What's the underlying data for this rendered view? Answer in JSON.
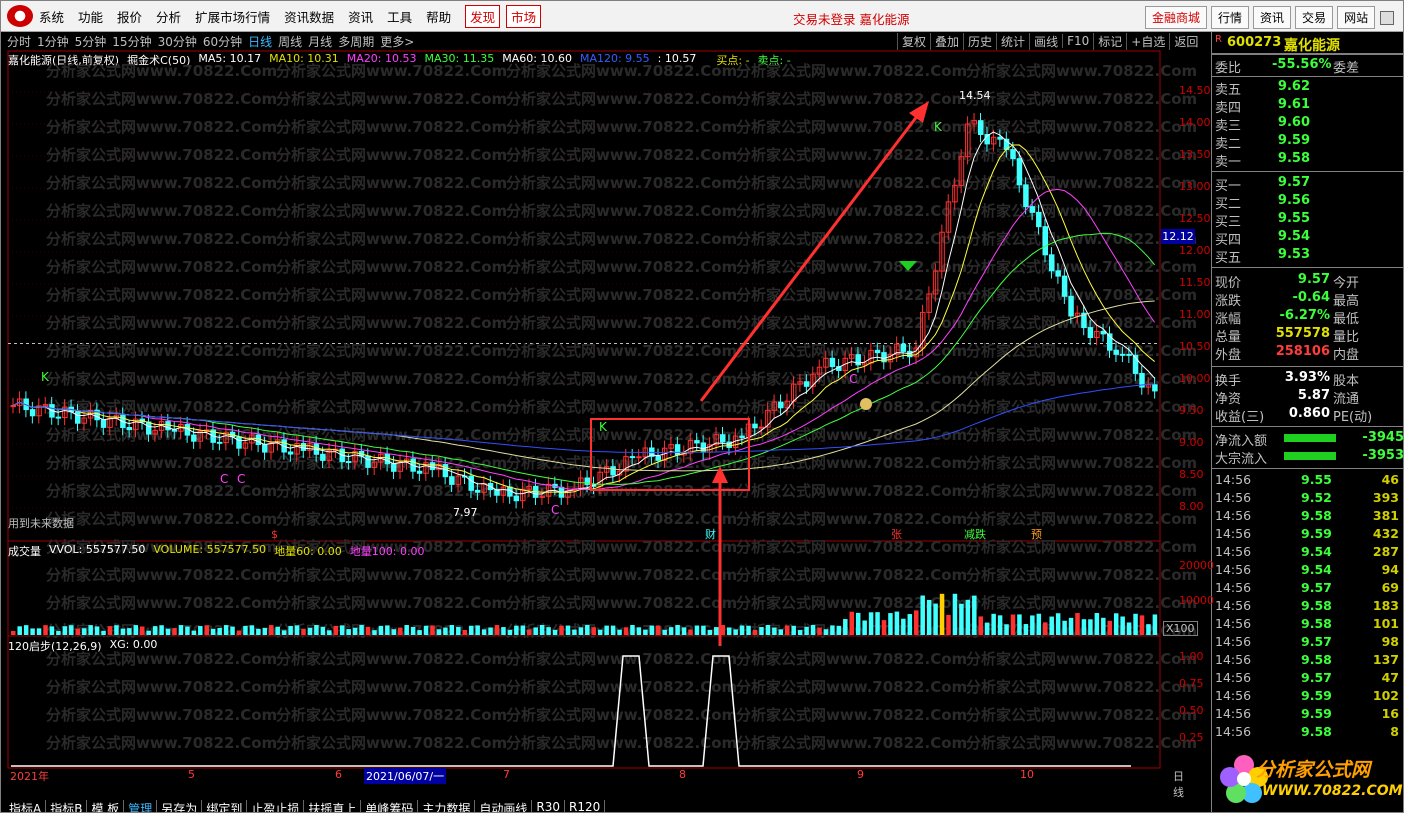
{
  "menu": {
    "items": [
      "系统",
      "功能",
      "报价",
      "分析",
      "扩展市场行情",
      "资讯数据",
      "资讯",
      "工具",
      "帮助"
    ],
    "red_items": [
      "发现",
      "市场"
    ],
    "center_text": "交易未登录  嘉化能源",
    "right_buttons": [
      "金融商城",
      "行情",
      "资讯",
      "交易",
      "网站"
    ]
  },
  "period": {
    "items": [
      "分时",
      "1分钟",
      "5分钟",
      "15分钟",
      "30分钟",
      "60分钟",
      "日线",
      "周线",
      "月线",
      "多周期",
      "更多>"
    ],
    "active": "日线",
    "tools": [
      "复权",
      "叠加",
      "历史",
      "统计",
      "画线",
      "F10",
      "标记",
      "+自选",
      "返回"
    ]
  },
  "chart_legend": {
    "name": "嘉化能源(日线,前复权)",
    "indicator": "掘金术C(50)",
    "ma5": "MA5: 10.17",
    "ma10": "MA10: 10.31",
    "ma20": "MA20: 10.53",
    "ma30": "MA30: 11.35",
    "ma60": "MA60: 10.60",
    "ma120": "MA120: 9.55",
    "extra": ": 10.57",
    "buy": "买点: -",
    "sell": "卖点: -"
  },
  "annotations": {
    "high": "14.54",
    "low": "7.97",
    "future_note": "用到未来数据",
    "current_price_tag": "12.12",
    "k1": "K",
    "k2": "K",
    "k3": "K",
    "c1": "C",
    "c2": "C",
    "c3": "C",
    "c4": "C"
  },
  "events": [
    "$",
    "财",
    "张",
    "减跌",
    "预"
  ],
  "volume_legend": {
    "name": "成交量",
    "vvol": "VVOL: 557577.50",
    "volume": "VOLUME: 557577.50",
    "dl60": "地量60: 0.00",
    "dl100": "地量100: 0.00",
    "x100": "X100"
  },
  "step_legend": {
    "name": "120启步(12,26,9)",
    "xg": "XG: 0.00"
  },
  "xaxis": {
    "labels": [
      "2021年",
      "5",
      "6",
      "2021/06/07/一",
      "7",
      "8",
      "9",
      "10"
    ],
    "right": "日线"
  },
  "tabs": [
    "指标A",
    "指标B",
    "模 板",
    "管理",
    "另存为",
    "绑定到",
    "止盈止损",
    "扶摇直上",
    "单峰筹码",
    "主力数据",
    "自动画线",
    "R30",
    "R120"
  ],
  "active_tab": "管理",
  "y_main": [
    "14.50",
    "14.00",
    "13.50",
    "13.00",
    "12.50",
    "12.00",
    "11.50",
    "11.00",
    "10.50",
    "10.00",
    "9.50",
    "9.00",
    "8.50",
    "8.00"
  ],
  "y_vol": [
    "20000",
    "10000"
  ],
  "y_step": [
    "1.00",
    "0.75",
    "0.50",
    "0.25"
  ],
  "watermark": "分析家公式网www.70822.Com",
  "quote": {
    "code": "600273",
    "name": "嘉化能源",
    "r": "R",
    "weibi_label": "委比",
    "weibi": "-55.56%",
    "weicha_label": "委差",
    "sell": [
      {
        "label": "卖五",
        "price": "9.62"
      },
      {
        "label": "卖四",
        "price": "9.61"
      },
      {
        "label": "卖三",
        "price": "9.60"
      },
      {
        "label": "卖二",
        "price": "9.59"
      },
      {
        "label": "卖一",
        "price": "9.58"
      }
    ],
    "buy": [
      {
        "label": "买一",
        "price": "9.57"
      },
      {
        "label": "买二",
        "price": "9.56"
      },
      {
        "label": "买三",
        "price": "9.55"
      },
      {
        "label": "买四",
        "price": "9.54"
      },
      {
        "label": "买五",
        "price": "9.53"
      }
    ],
    "stats": [
      {
        "label": "现价",
        "value": "9.57",
        "right": "今开"
      },
      {
        "label": "涨跌",
        "value": "-0.64",
        "right": "最高"
      },
      {
        "label": "涨幅",
        "value": "-6.27%",
        "right": "最低"
      },
      {
        "label": "总量",
        "value": "557578",
        "right": "量比"
      },
      {
        "label": "外盘",
        "value": "258106",
        "right": "内盘"
      }
    ],
    "stats2": [
      {
        "label": "换手",
        "value": "3.93%",
        "right": "股本"
      },
      {
        "label": "净资",
        "value": "5.87",
        "right": "流通"
      },
      {
        "label": "收益(三)",
        "value": "0.860",
        "right": "PE(动)"
      }
    ],
    "flow": [
      {
        "label": "净流入额",
        "value": "-3945"
      },
      {
        "label": "大宗流入",
        "value": "-3953"
      }
    ],
    "ticks": [
      {
        "t": "14:56",
        "p": "9.55",
        "v": "46"
      },
      {
        "t": "14:56",
        "p": "9.52",
        "v": "393"
      },
      {
        "t": "14:56",
        "p": "9.58",
        "v": "381"
      },
      {
        "t": "14:56",
        "p": "9.59",
        "v": "432"
      },
      {
        "t": "14:56",
        "p": "9.54",
        "v": "287"
      },
      {
        "t": "14:56",
        "p": "9.54",
        "v": "94"
      },
      {
        "t": "14:56",
        "p": "9.57",
        "v": "69"
      },
      {
        "t": "14:56",
        "p": "9.58",
        "v": "183"
      },
      {
        "t": "14:56",
        "p": "9.58",
        "v": "101"
      },
      {
        "t": "14:56",
        "p": "9.57",
        "v": "98"
      },
      {
        "t": "14:56",
        "p": "9.58",
        "v": "137"
      },
      {
        "t": "14:56",
        "p": "9.57",
        "v": "47"
      },
      {
        "t": "14:56",
        "p": "9.59",
        "v": "102"
      },
      {
        "t": "14:56",
        "p": "9.59",
        "v": "16"
      },
      {
        "t": "14:56",
        "p": "9.58",
        "v": "8"
      }
    ]
  },
  "brand": {
    "name": "分析家公式网",
    "url": "WWW.70822.COM"
  }
}
